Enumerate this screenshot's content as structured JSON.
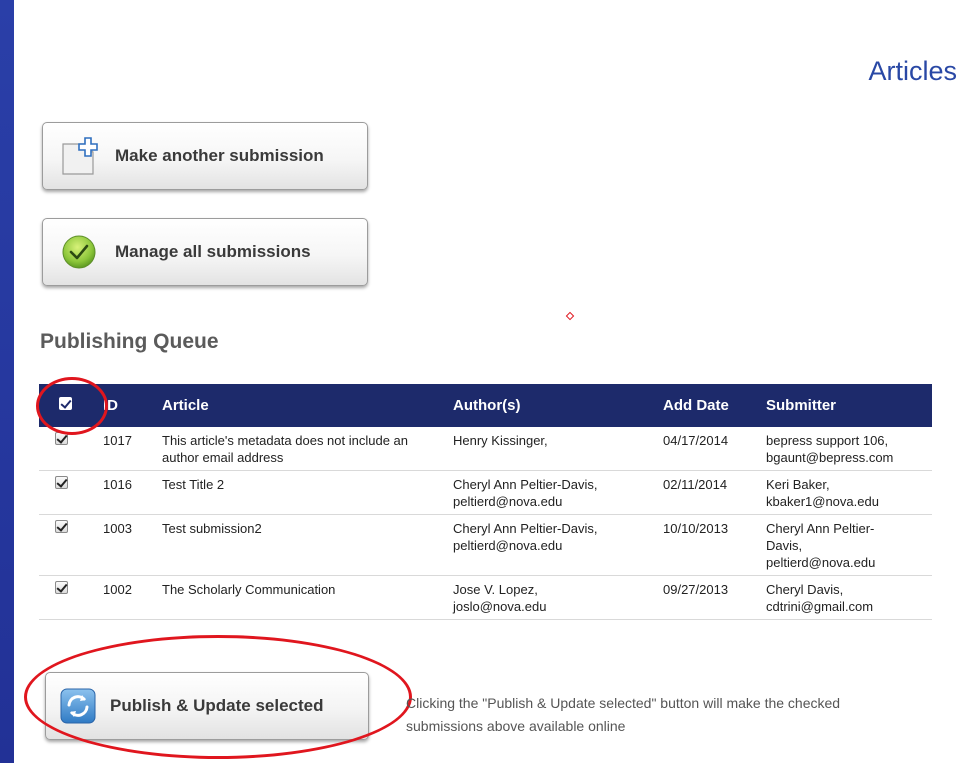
{
  "page": {
    "title": "Articles"
  },
  "actions": {
    "make_submission_label": "Make another submission",
    "manage_submissions_label": "Manage all submissions"
  },
  "queue": {
    "title": "Publishing Queue",
    "columns": [
      "ID",
      "Article",
      "Author(s)",
      "Add Date",
      "Submitter"
    ],
    "rows": [
      {
        "checked": true,
        "id": "1017",
        "article": "This article's metadata does not include an author email address",
        "authors": [
          "Henry Kissinger,"
        ],
        "add_date": "04/17/2014",
        "submitter": [
          "bepress support 106,",
          "bgaunt@bepress.com"
        ]
      },
      {
        "checked": true,
        "id": "1016",
        "article": "Test Title 2",
        "authors": [
          "Cheryl Ann Peltier-Davis,",
          "peltierd@nova.edu"
        ],
        "add_date": "02/11/2014",
        "submitter": [
          "Keri Baker,",
          "kbaker1@nova.edu"
        ]
      },
      {
        "checked": true,
        "id": "1003",
        "article": "Test submission2",
        "authors": [
          "Cheryl Ann Peltier-Davis,",
          "peltierd@nova.edu"
        ],
        "add_date": "10/10/2013",
        "submitter": [
          "Cheryl Ann Peltier-",
          "Davis,",
          "peltierd@nova.edu"
        ]
      },
      {
        "checked": true,
        "id": "1002",
        "article": "The Scholarly Communication",
        "authors": [
          "Jose V. Lopez,",
          "joslo@nova.edu"
        ],
        "add_date": "09/27/2013",
        "submitter": [
          "Cheryl Davis,",
          "cdtrini@gmail.com"
        ]
      }
    ]
  },
  "publish": {
    "button_label": "Publish & Update selected",
    "note": "Clicking the \"Publish & Update selected\" button will make the checked submissions above available online"
  },
  "icons": {
    "make_submission": "add-document-icon",
    "manage_submissions": "green-check-icon",
    "publish": "refresh-arrows-icon"
  },
  "colors": {
    "background": "#2a3fa8",
    "table_header": "#1d2a6b",
    "title": "#2948a5",
    "annotation": "#e0161e"
  }
}
